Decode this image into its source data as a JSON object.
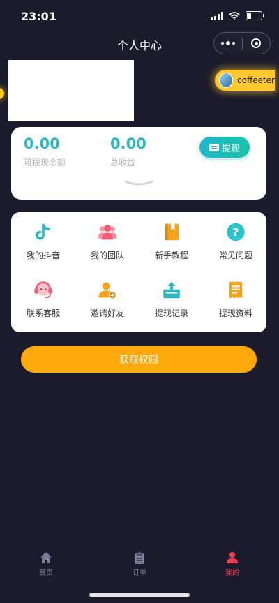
{
  "status_bar": {
    "time": "23:01"
  },
  "nav": {
    "title": "个人中心"
  },
  "user": {
    "name": "coffeeter"
  },
  "balance": {
    "withdrawable_amount": "0.00",
    "withdrawable_label": "可提现余额",
    "total_income_amount": "0.00",
    "total_income_label": "总收益",
    "withdraw_button": "提现"
  },
  "features": {
    "items": [
      {
        "label": "我的抖音",
        "icon": "douyin-icon"
      },
      {
        "label": "我的团队",
        "icon": "team-icon"
      },
      {
        "label": "新手教程",
        "icon": "book-icon"
      },
      {
        "label": "常见问题",
        "icon": "question-icon"
      },
      {
        "label": "联系客服",
        "icon": "headset-icon"
      },
      {
        "label": "邀请好友",
        "icon": "add-user-icon"
      },
      {
        "label": "提现记录",
        "icon": "upload-box-icon"
      },
      {
        "label": "提现资料",
        "icon": "receipt-icon"
      }
    ]
  },
  "primary_button": {
    "label": "获取权限"
  },
  "tabbar": {
    "items": [
      {
        "label": "首页",
        "icon": "home-icon"
      },
      {
        "label": "订单",
        "icon": "clipboard-icon"
      },
      {
        "label": "我的",
        "icon": "person-icon",
        "active": true
      }
    ]
  },
  "colors": {
    "background": "#1b1b2c",
    "accent_teal": "#2cb7c2",
    "accent_orange": "#ffa90c",
    "chip_yellow": "#ffc82e",
    "active_tab": "#ff3a4e"
  }
}
